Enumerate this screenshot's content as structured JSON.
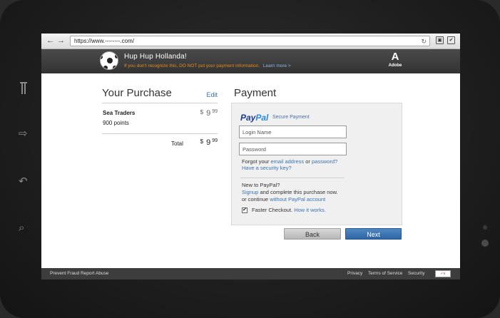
{
  "browser": {
    "url": "https://www.--------.com/"
  },
  "header": {
    "title": "Hup Hup Hollanda!",
    "warning": "If you don't recognize this, DO NOT put your payment information.",
    "learn_more": "Learn more >",
    "logo_text": "Adobe"
  },
  "purchase": {
    "title": "Your Purchase",
    "edit_label": "Edit",
    "item": {
      "name": "Sea Traders",
      "points": "900 points",
      "price_currency": "$",
      "price_dollars": "9",
      "price_cents": "99"
    },
    "total_label": "Total",
    "total": {
      "currency": "$",
      "dollars": "9",
      "cents": "99"
    }
  },
  "payment": {
    "title": "Payment",
    "logo_pay": "Pay",
    "logo_pal": "Pal",
    "secure_label": "Secure Payment",
    "login_placeholder": "Login Name",
    "password_placeholder": "Password",
    "forgot_prefix": "Forgot your",
    "forgot_email": "email address",
    "forgot_or": "or",
    "forgot_password": "password?",
    "security_key": "Have a security key?",
    "new_prompt": "New to PayPal?",
    "signup": "Signup",
    "signup_rest": "and complete this purchase now.",
    "continue_prefix": "or continue",
    "without_account": "without PayPal account",
    "faster_label": "Faster Checkout.",
    "how_it_works": "How it works.",
    "faster_checked": true
  },
  "buttons": {
    "back": "Back",
    "next": "Next"
  },
  "footer": {
    "left": "Prevent Fraud Report Abuse",
    "privacy": "Privacy",
    "terms": "Terms of Service",
    "security": "Security"
  },
  "colors": {
    "link": "#3a73b5",
    "warning": "#e38b1d",
    "next_button": "#2f66a6",
    "header_bg": "#3a3a3a"
  }
}
